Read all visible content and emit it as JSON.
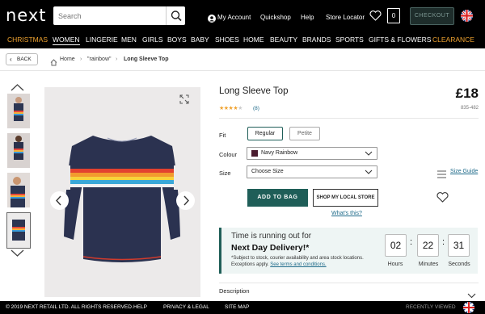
{
  "header": {
    "logo": "next",
    "search_placeholder": "Search",
    "my_account": "My Account",
    "quickshop": "Quickshop",
    "help": "Help",
    "store_locator": "Store Locator",
    "bag_count": "0",
    "checkout": "CHECKOUT"
  },
  "nav": [
    "CHRISTMAS",
    "WOMEN",
    "LINGERIE",
    "MEN",
    "GIRLS",
    "BOYS",
    "BABY",
    "SHOES",
    "HOME",
    "BEAUTY",
    "BRANDS",
    "SPORTS",
    "GIFTS & FLOWERS",
    "CLEARANCE"
  ],
  "breadcrumb": {
    "back": "BACK",
    "home": "Home",
    "search": "\"rainbow\"",
    "current": "Long Sleeve Top"
  },
  "product": {
    "title": "Long Sleeve Top",
    "price": "£18",
    "code": "835-482",
    "rating_stars": 4,
    "review_count": "(8)",
    "fit_label": "Fit",
    "fit_options": [
      "Regular",
      "Petite"
    ],
    "colour_label": "Colour",
    "colour_value": "Navy Rainbow",
    "size_label": "Size",
    "size_value": "Choose Size",
    "size_guide": "Size Guide",
    "add_to_bag": "ADD TO BAG",
    "shop_local": "SHOP MY LOCAL STORE",
    "whats_this": "What's this?"
  },
  "delivery": {
    "line1": "Time is running out for",
    "line2": "Next Day Delivery!*",
    "note1": "*Subject to stock, courier availability and area stock locations.",
    "note2_prefix": "Exceptions apply. ",
    "note2_link": "See terms and conditions.",
    "hours": "02",
    "minutes": "22",
    "seconds": "31",
    "hours_label": "Hours",
    "minutes_label": "Minutes",
    "seconds_label": "Seconds"
  },
  "description_label": "Description",
  "footer": {
    "copyright": "© 2019 NEXT RETAIL LTD. ALL RIGHTS RESERVED.",
    "help": "HELP",
    "privacy": "PRIVACY & LEGAL",
    "sitemap": "SITE MAP",
    "recently_viewed": "RECENTLY VIEWED"
  },
  "colors": {
    "accent": "#1f5e58",
    "link": "#1f6b8a",
    "orange": "#f0a330"
  }
}
